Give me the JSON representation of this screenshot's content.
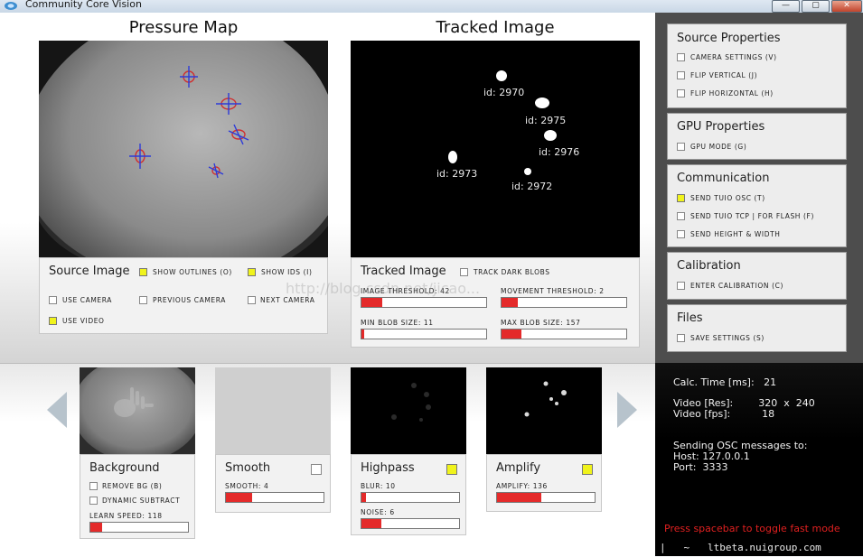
{
  "window": {
    "title": "Community Core Vision",
    "buttons": [
      "—",
      "▢",
      "✕"
    ]
  },
  "pressure_map": {
    "title": "Pressure Map",
    "source": {
      "title": "Source Image",
      "show_outlines": {
        "label": "Show Outlines (O)",
        "checked": true
      },
      "show_ids": {
        "label": "Show IDs (I)",
        "checked": true
      },
      "use_camera": {
        "label": "Use Camera",
        "checked": false
      },
      "previous_camera": {
        "label": "Previous Camera",
        "checked": false
      },
      "next_camera": {
        "label": "Next Camera",
        "checked": false
      },
      "use_video": {
        "label": "Use Video",
        "checked": true
      }
    }
  },
  "tracked": {
    "title": "Tracked Image",
    "blobs": [
      "id: 2970",
      "id: 2975",
      "id: 2976",
      "id: 2973",
      "id: 2972"
    ],
    "controls": {
      "title": "Tracked Image",
      "track_dark": {
        "label": "Track Dark Blobs",
        "checked": false
      },
      "image_threshold": {
        "label": "Image Threshold: 42",
        "value": 42,
        "max": 255
      },
      "movement_threshold": {
        "label": "Movement Threshold: 2",
        "value": 2,
        "max": 15
      },
      "min_blob": {
        "label": "Min Blob Size: 11",
        "value": 11,
        "max": 500
      },
      "max_blob": {
        "label": "Max Blob Size: 157",
        "value": 157,
        "max": 1000
      }
    }
  },
  "watermark": "http://blog.csdn.net/jicao...",
  "sidebar": {
    "source_properties": {
      "title": "Source Properties",
      "items": [
        {
          "label": "Camera Settings (V)",
          "checked": false
        },
        {
          "label": "Flip Vertical (J)",
          "checked": false
        },
        {
          "label": "Flip Horizontal (H)",
          "checked": false
        }
      ]
    },
    "gpu_properties": {
      "title": "GPU Properties",
      "items": [
        {
          "label": "GPU Mode (G)",
          "checked": false
        }
      ]
    },
    "communication": {
      "title": "Communication",
      "items": [
        {
          "label": "Send TUIO OSC (T)",
          "checked": true
        },
        {
          "label": "Send TUIO TCP | for Flash (F)",
          "checked": false
        },
        {
          "label": "Send Height & Width",
          "checked": false
        }
      ]
    },
    "calibration": {
      "title": "Calibration",
      "items": [
        {
          "label": "Enter Calibration (C)",
          "checked": false
        }
      ]
    },
    "files": {
      "title": "Files",
      "items": [
        {
          "label": "Save Settings (S)",
          "checked": false
        }
      ]
    }
  },
  "filters": {
    "background": {
      "title": "Background",
      "remove_bg": {
        "label": "Remove BG (B)",
        "checked": false
      },
      "dynamic": {
        "label": "Dynamic Subtract",
        "checked": false
      },
      "learn_speed": {
        "label": "Learn Speed: 118",
        "value": 118,
        "max": 1000
      }
    },
    "smooth": {
      "title": "Smooth",
      "checked": false,
      "smooth": {
        "label": "Smooth: 4",
        "value": 4,
        "max": 15
      }
    },
    "highpass": {
      "title": "Highpass",
      "checked": true,
      "blur": {
        "label": "Blur: 10",
        "value": 10,
        "max": 200
      },
      "noise": {
        "label": "Noise: 6",
        "value": 6,
        "max": 30
      }
    },
    "amplify": {
      "title": "Amplify",
      "checked": true,
      "amplify": {
        "label": "Amplify: 136",
        "value": 136,
        "max": 300
      }
    }
  },
  "info": {
    "calc_time": "Calc. Time [ms]:   21",
    "video_res": "Video [Res]:        320  x  240",
    "video_fps": "Video [fps]:          18",
    "sending": "Sending OSC messages to:",
    "host": "Host: 127.0.0.1",
    "port": "Port:  3333",
    "hint": "Press spacebar to toggle fast mode",
    "footer": "|   ~   ltbeta.nuigroup.com"
  },
  "colors": {
    "accent_slider": "#e42a2a",
    "checkbox_on": "#f0f31c",
    "sidebar_bg": "#4d4d4d",
    "hint_text": "#e02020"
  }
}
